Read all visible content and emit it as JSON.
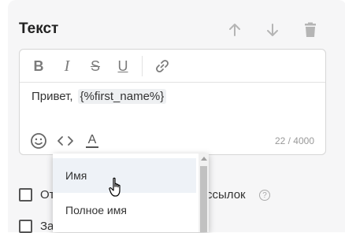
{
  "section": {
    "title": "Текст",
    "move_up_icon": "arrow-up-icon",
    "move_down_icon": "arrow-down-icon",
    "delete_icon": "trash-icon"
  },
  "editor": {
    "toolbar": {
      "bold_label": "B",
      "italic_label": "I",
      "strike_label": "S",
      "underline_label": "U",
      "link_icon": "link-icon"
    },
    "text": "Привет,",
    "variable": "{%first_name%}",
    "counter": "22 / 4000",
    "emoji_icon": "emoji-icon",
    "code_icon": "code-icon",
    "text_color_label": "A"
  },
  "dropdown": {
    "items": [
      {
        "label": "Имя"
      },
      {
        "label": "Полное имя"
      }
    ]
  },
  "checkboxes": [
    {
      "label_start": "От",
      "label_end": "ссылок"
    },
    {
      "label_start": "За"
    }
  ],
  "colors": {
    "panel_bg": "#f6f6f7",
    "icon_gray": "#b5b5b5"
  }
}
